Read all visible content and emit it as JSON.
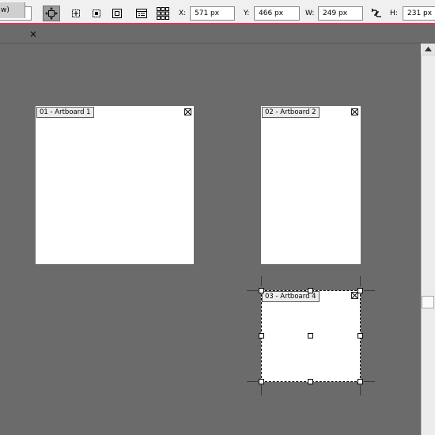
{
  "control_bar": {
    "x_label": "X:",
    "x_value": "571 px",
    "y_label": "Y:",
    "y_value": "466 px",
    "w_label": "W:",
    "w_value": "249 px",
    "h_label": "H:",
    "h_value": "231 px",
    "accent_color": "#e4335a",
    "tools": [
      "move-artboard-icon",
      "new-artboard-icon",
      "fit-artboard-icon",
      "artboard-bounds-icon",
      "artboard-options-icon",
      "rearrange-grid-icon",
      "link-constrain-icon"
    ]
  },
  "tab": {
    "label": "w)",
    "close": "×"
  },
  "artboards": [
    {
      "label": "01 - Artboard 1"
    },
    {
      "label": "02 - Artboard 2"
    },
    {
      "label": "03 - Artboard 4"
    }
  ]
}
